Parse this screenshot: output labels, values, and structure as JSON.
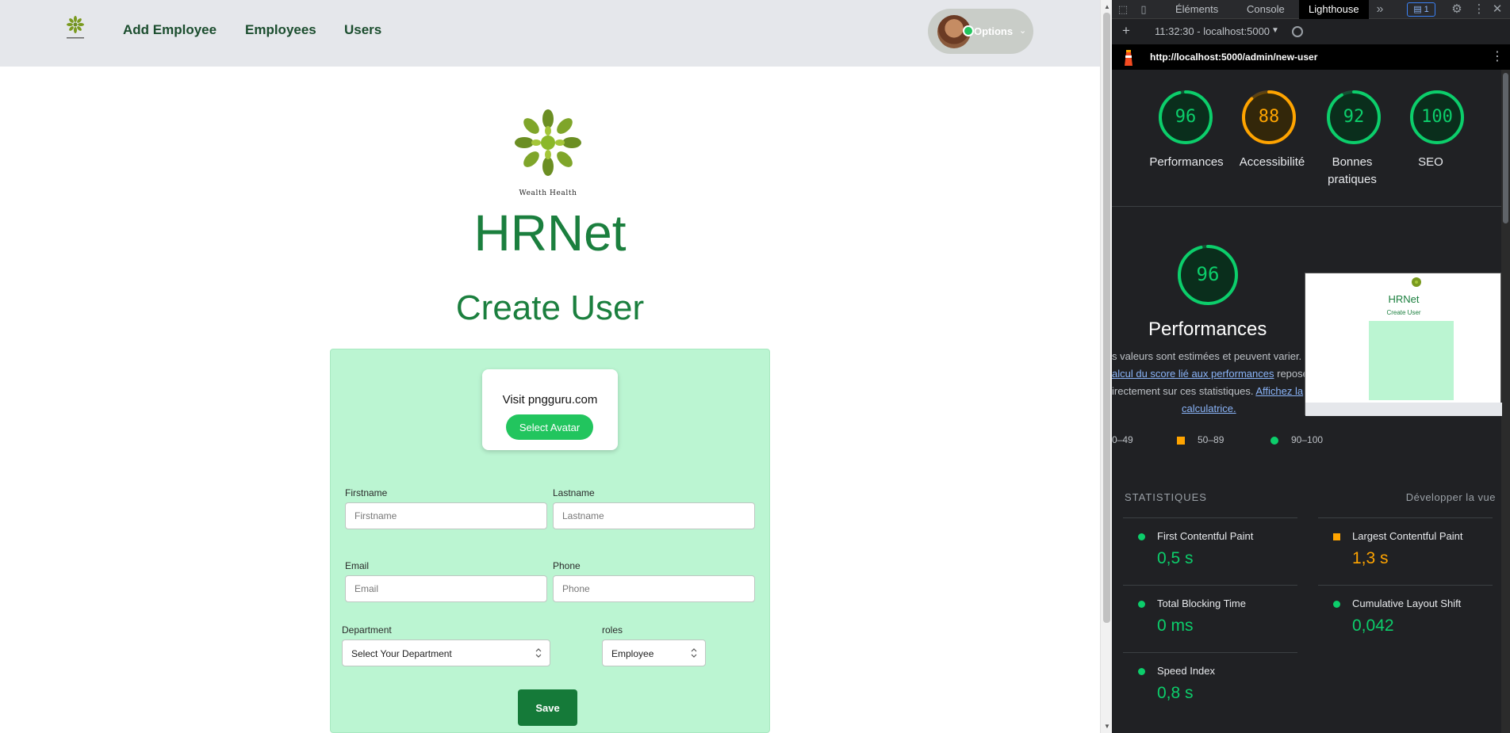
{
  "app": {
    "nav": {
      "links": [
        "Add Employee",
        "Employees",
        "Users"
      ],
      "options_label": "Options"
    },
    "logo_caption": "Wealth Health",
    "title": "HRNet",
    "page_title": "Create User",
    "avatar_box": {
      "visit_text": "Visit pngguru.com",
      "select_avatar_label": "Select Avatar"
    },
    "form": {
      "firstname_label": "Firstname",
      "firstname_placeholder": "Firstname",
      "lastname_label": "Lastname",
      "lastname_placeholder": "Lastname",
      "email_label": "Email",
      "email_placeholder": "Email",
      "phone_label": "Phone",
      "phone_placeholder": "Phone",
      "department_label": "Department",
      "department_value": "Select Your Department",
      "roles_label": "roles",
      "roles_value": "Employee",
      "save_label": "Save"
    },
    "colors": {
      "brand_green": "#1b7f3e",
      "card_bg": "#bbf5d2",
      "button_green": "#22c55e",
      "save_green": "#157a39",
      "nav_bg": "#e5e7eb"
    }
  },
  "devtools": {
    "tabs": [
      "Éléments",
      "Console",
      "Lighthouse"
    ],
    "active_tab": "Lighthouse",
    "badge_count": "1",
    "session": "11:32:30 - localhost:5000",
    "url": "http://localhost:5000/admin/new-user",
    "scores": [
      {
        "value": 96,
        "label": "Performances",
        "color": "#0cce6b"
      },
      {
        "value": 88,
        "label": "Accessibilité",
        "color": "#ffa400"
      },
      {
        "value": 92,
        "label": "Bonnes pratiques",
        "color": "#0cce6b"
      },
      {
        "value": 100,
        "label": "SEO",
        "color": "#0cce6b"
      }
    ],
    "performance": {
      "score": 96,
      "title": "Performances",
      "desc_line1": "s valeurs sont estimées et peuvent varier.",
      "desc_line2_link": "alcul du score lié aux performances",
      "desc_line2_rest": " repose",
      "desc_line3": "irectement sur ces statistiques. ",
      "desc_line3_link": "Affichez la",
      "desc_line4_link": "calculatrice."
    },
    "thumbnail": {
      "title": "HRNet",
      "subtitle": "Create User"
    },
    "legend": [
      "0–49",
      "50–89",
      "90–100"
    ],
    "stats_header": "STATISTIQUES",
    "expand_label": "Développer la vue",
    "metrics": [
      {
        "name": "First Contentful Paint",
        "value": "0,5 s",
        "status": "pass"
      },
      {
        "name": "Largest Contentful Paint",
        "value": "1,3 s",
        "status": "average"
      },
      {
        "name": "Total Blocking Time",
        "value": "0 ms",
        "status": "pass"
      },
      {
        "name": "Cumulative Layout Shift",
        "value": "0,042",
        "status": "pass"
      },
      {
        "name": "Speed Index",
        "value": "0,8 s",
        "status": "pass"
      }
    ]
  }
}
